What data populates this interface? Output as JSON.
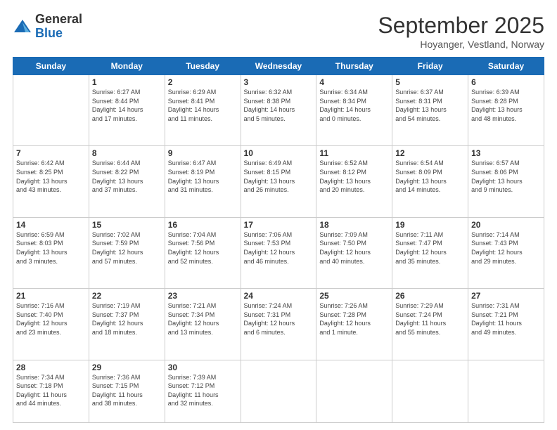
{
  "logo": {
    "general": "General",
    "blue": "Blue"
  },
  "header": {
    "month": "September 2025",
    "location": "Hoyanger, Vestland, Norway"
  },
  "days_of_week": [
    "Sunday",
    "Monday",
    "Tuesday",
    "Wednesday",
    "Thursday",
    "Friday",
    "Saturday"
  ],
  "weeks": [
    [
      {
        "day": "",
        "info": ""
      },
      {
        "day": "1",
        "info": "Sunrise: 6:27 AM\nSunset: 8:44 PM\nDaylight: 14 hours\nand 17 minutes."
      },
      {
        "day": "2",
        "info": "Sunrise: 6:29 AM\nSunset: 8:41 PM\nDaylight: 14 hours\nand 11 minutes."
      },
      {
        "day": "3",
        "info": "Sunrise: 6:32 AM\nSunset: 8:38 PM\nDaylight: 14 hours\nand 5 minutes."
      },
      {
        "day": "4",
        "info": "Sunrise: 6:34 AM\nSunset: 8:34 PM\nDaylight: 14 hours\nand 0 minutes."
      },
      {
        "day": "5",
        "info": "Sunrise: 6:37 AM\nSunset: 8:31 PM\nDaylight: 13 hours\nand 54 minutes."
      },
      {
        "day": "6",
        "info": "Sunrise: 6:39 AM\nSunset: 8:28 PM\nDaylight: 13 hours\nand 48 minutes."
      }
    ],
    [
      {
        "day": "7",
        "info": "Sunrise: 6:42 AM\nSunset: 8:25 PM\nDaylight: 13 hours\nand 43 minutes."
      },
      {
        "day": "8",
        "info": "Sunrise: 6:44 AM\nSunset: 8:22 PM\nDaylight: 13 hours\nand 37 minutes."
      },
      {
        "day": "9",
        "info": "Sunrise: 6:47 AM\nSunset: 8:19 PM\nDaylight: 13 hours\nand 31 minutes."
      },
      {
        "day": "10",
        "info": "Sunrise: 6:49 AM\nSunset: 8:15 PM\nDaylight: 13 hours\nand 26 minutes."
      },
      {
        "day": "11",
        "info": "Sunrise: 6:52 AM\nSunset: 8:12 PM\nDaylight: 13 hours\nand 20 minutes."
      },
      {
        "day": "12",
        "info": "Sunrise: 6:54 AM\nSunset: 8:09 PM\nDaylight: 13 hours\nand 14 minutes."
      },
      {
        "day": "13",
        "info": "Sunrise: 6:57 AM\nSunset: 8:06 PM\nDaylight: 13 hours\nand 9 minutes."
      }
    ],
    [
      {
        "day": "14",
        "info": "Sunrise: 6:59 AM\nSunset: 8:03 PM\nDaylight: 13 hours\nand 3 minutes."
      },
      {
        "day": "15",
        "info": "Sunrise: 7:02 AM\nSunset: 7:59 PM\nDaylight: 12 hours\nand 57 minutes."
      },
      {
        "day": "16",
        "info": "Sunrise: 7:04 AM\nSunset: 7:56 PM\nDaylight: 12 hours\nand 52 minutes."
      },
      {
        "day": "17",
        "info": "Sunrise: 7:06 AM\nSunset: 7:53 PM\nDaylight: 12 hours\nand 46 minutes."
      },
      {
        "day": "18",
        "info": "Sunrise: 7:09 AM\nSunset: 7:50 PM\nDaylight: 12 hours\nand 40 minutes."
      },
      {
        "day": "19",
        "info": "Sunrise: 7:11 AM\nSunset: 7:47 PM\nDaylight: 12 hours\nand 35 minutes."
      },
      {
        "day": "20",
        "info": "Sunrise: 7:14 AM\nSunset: 7:43 PM\nDaylight: 12 hours\nand 29 minutes."
      }
    ],
    [
      {
        "day": "21",
        "info": "Sunrise: 7:16 AM\nSunset: 7:40 PM\nDaylight: 12 hours\nand 23 minutes."
      },
      {
        "day": "22",
        "info": "Sunrise: 7:19 AM\nSunset: 7:37 PM\nDaylight: 12 hours\nand 18 minutes."
      },
      {
        "day": "23",
        "info": "Sunrise: 7:21 AM\nSunset: 7:34 PM\nDaylight: 12 hours\nand 13 minutes."
      },
      {
        "day": "24",
        "info": "Sunrise: 7:24 AM\nSunset: 7:31 PM\nDaylight: 12 hours\nand 6 minutes."
      },
      {
        "day": "25",
        "info": "Sunrise: 7:26 AM\nSunset: 7:28 PM\nDaylight: 12 hours\nand 1 minute."
      },
      {
        "day": "26",
        "info": "Sunrise: 7:29 AM\nSunset: 7:24 PM\nDaylight: 11 hours\nand 55 minutes."
      },
      {
        "day": "27",
        "info": "Sunrise: 7:31 AM\nSunset: 7:21 PM\nDaylight: 11 hours\nand 49 minutes."
      }
    ],
    [
      {
        "day": "28",
        "info": "Sunrise: 7:34 AM\nSunset: 7:18 PM\nDaylight: 11 hours\nand 44 minutes."
      },
      {
        "day": "29",
        "info": "Sunrise: 7:36 AM\nSunset: 7:15 PM\nDaylight: 11 hours\nand 38 minutes."
      },
      {
        "day": "30",
        "info": "Sunrise: 7:39 AM\nSunset: 7:12 PM\nDaylight: 11 hours\nand 32 minutes."
      },
      {
        "day": "",
        "info": ""
      },
      {
        "day": "",
        "info": ""
      },
      {
        "day": "",
        "info": ""
      },
      {
        "day": "",
        "info": ""
      }
    ]
  ]
}
